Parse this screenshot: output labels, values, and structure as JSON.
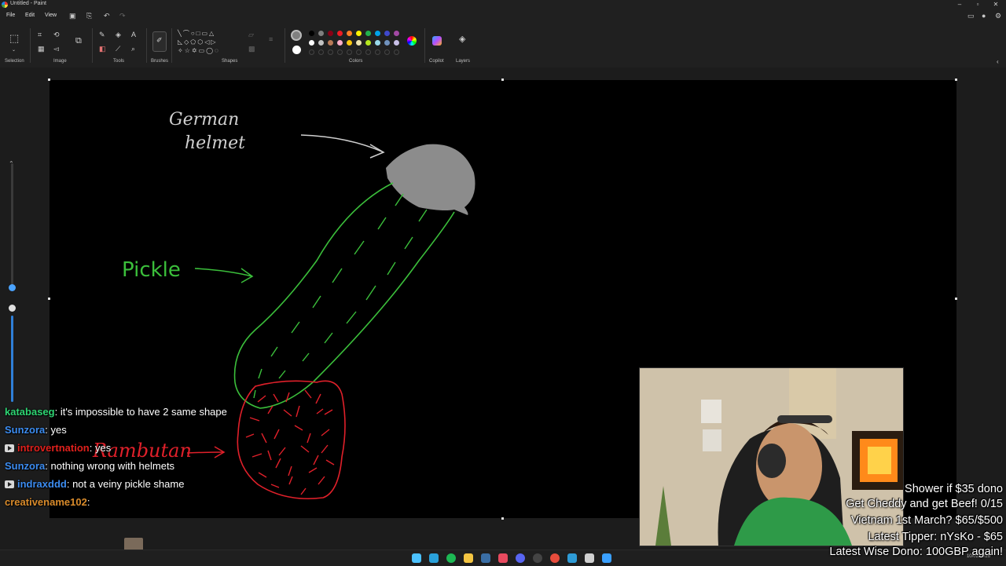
{
  "window": {
    "title": "Untitled - Paint",
    "controls": [
      "–",
      "▫",
      "✕"
    ]
  },
  "menu": {
    "file": "File",
    "edit": "Edit",
    "view": "View"
  },
  "ribbon": {
    "groups": {
      "selection": "Selection",
      "image": "Image",
      "tools": "Tools",
      "brushes": "Brushes",
      "shapes": "Shapes",
      "colors": "Colors",
      "copilot": "Copilot",
      "layers": "Layers"
    },
    "palette_row1": [
      "#000000",
      "#7f7f7f",
      "#880015",
      "#ed1c24",
      "#ff7f27",
      "#fff200",
      "#22b14c",
      "#00a2e8",
      "#3f48cc",
      "#a349a4"
    ],
    "palette_row2": [
      "#ffffff",
      "#c3c3c3",
      "#b97a57",
      "#ffaec9",
      "#ffc90e",
      "#efe4b0",
      "#b5e61d",
      "#99d9ea",
      "#7092be",
      "#c8bfe7"
    ],
    "current_color_1": "#808080",
    "current_color_2": "#ffffff"
  },
  "drawing": {
    "label_helmet": "German helmet",
    "label_pickle": "Pickle",
    "label_rambutan": "Rambutan",
    "helmet_color": "#8c8c8c",
    "pickle_color": "#3bbf3b",
    "rambutan_color": "#e0202a",
    "arrow_color": "#cfcfcf"
  },
  "chat": [
    {
      "user": "katabaseg",
      "color": "#2ed573",
      "badge": false,
      "text": "it's impossible to have 2 same shape"
    },
    {
      "user": "Sunzora",
      "color": "#3c8cf0",
      "badge": false,
      "text": "yes"
    },
    {
      "user": "introvertnation",
      "color": "#e0201c",
      "badge": true,
      "text": "yes"
    },
    {
      "user": "Sunzora",
      "color": "#3c8cf0",
      "badge": false,
      "text": "nothing wrong with helmets"
    },
    {
      "user": "indraxddd",
      "color": "#3c8cf0",
      "badge": true,
      "text": "not a veiny pickle shame"
    },
    {
      "user": "creativename102",
      "color": "#d98b2b",
      "badge": false,
      "text": ""
    }
  ],
  "overlay": {
    "line1": "Shower if $35 dono",
    "line2": "Get Cheddy and get Beef! 0/15",
    "line3": "Vietnam 1st March? $65/$500",
    "line4": "Latest Tipper: nYsKo - $65",
    "line5": "Latest Wise Dono: 100GBP again!"
  },
  "taskbar": {
    "icons": [
      "windows-start",
      "telegram",
      "spotify",
      "file-explorer",
      "steam",
      "game-launcher",
      "discord",
      "obs",
      "chrome",
      "edge",
      "ccleaner",
      "paint"
    ],
    "clock_time": "",
    "clock_date": "10/02/2026"
  }
}
